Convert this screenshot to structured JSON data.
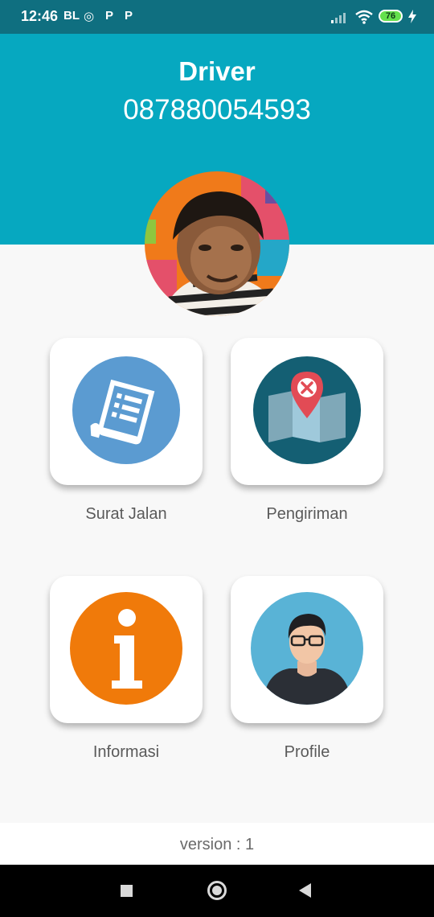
{
  "status_bar": {
    "time": "12:46",
    "notifications": [
      "BL",
      "◎",
      "P",
      "P"
    ],
    "battery": "76"
  },
  "header": {
    "role": "Driver",
    "phone": "087880054593"
  },
  "menu": [
    {
      "label": "Surat Jalan",
      "icon": "document-icon"
    },
    {
      "label": "Pengiriman",
      "icon": "map-pin-icon"
    },
    {
      "label": "Informasi",
      "icon": "info-icon"
    },
    {
      "label": "Profile",
      "icon": "user-icon"
    }
  ],
  "footer": {
    "version": "version : 1"
  },
  "colors": {
    "header": "#06a8c0",
    "status_bar": "#0f6f80",
    "document_icon_bg": "#5b9bd1",
    "map_icon_bg": "#145f73",
    "info_icon_bg": "#f07a0a",
    "profile_icon_bg": "#59b3d6"
  }
}
